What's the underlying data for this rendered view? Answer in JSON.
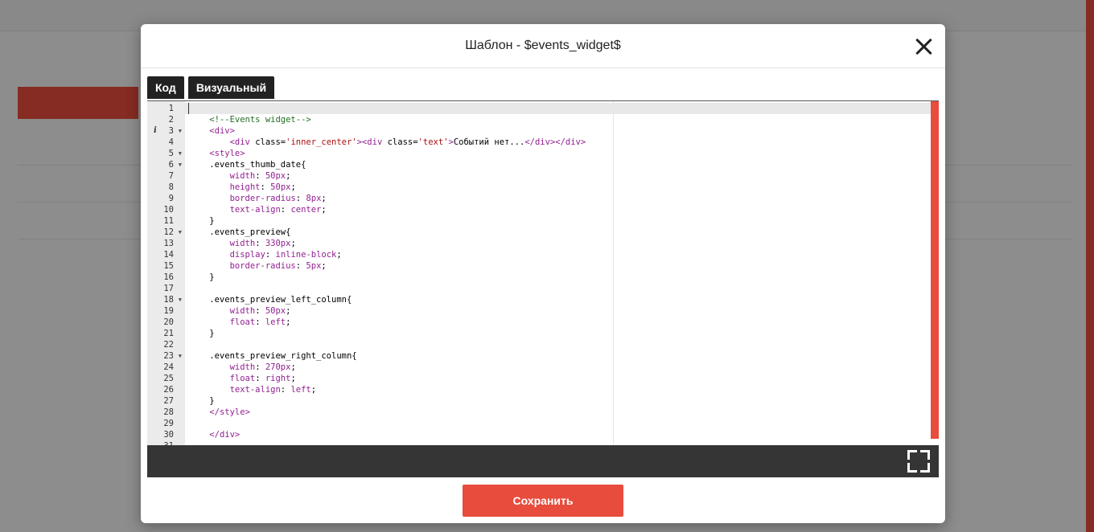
{
  "modal": {
    "title": "Шаблон - $events_widget$",
    "tabs": [
      {
        "label": "Код"
      },
      {
        "label": "Визуальный"
      }
    ],
    "save_label": "Сохранить"
  },
  "editor": {
    "info_line": 3,
    "fold_lines": [
      3,
      5,
      6,
      12,
      18,
      23
    ],
    "lines": [
      "",
      "    <!--Events widget-->",
      "    <div>",
      "        <div class='inner_center'><div class='text'>Событий нет...</div></div>",
      "    <style>",
      "    .events_thumb_date{",
      "        width: 50px;",
      "        height: 50px;",
      "        border-radius: 8px;",
      "        text-align: center;",
      "    }",
      "    .events_preview{",
      "        width: 330px;",
      "        display: inline-block;",
      "        border-radius: 5px;",
      "    }",
      "",
      "    .events_preview_left_column{",
      "        width: 50px;",
      "        float: left;",
      "    }",
      "",
      "    .events_preview_right_column{",
      "        width: 270px;",
      "        float: right;",
      "        text-align: left;",
      "    }",
      "    </style>",
      "",
      "    </div>",
      ""
    ]
  },
  "icons": {
    "close": "close-icon",
    "fullscreen": "fullscreen-icon",
    "info": "info-icon",
    "fold": "fold-arrow-icon"
  },
  "colors": {
    "accent": "#e74c3c",
    "editor_footer": "#353535",
    "tab_bg": "#222222"
  }
}
